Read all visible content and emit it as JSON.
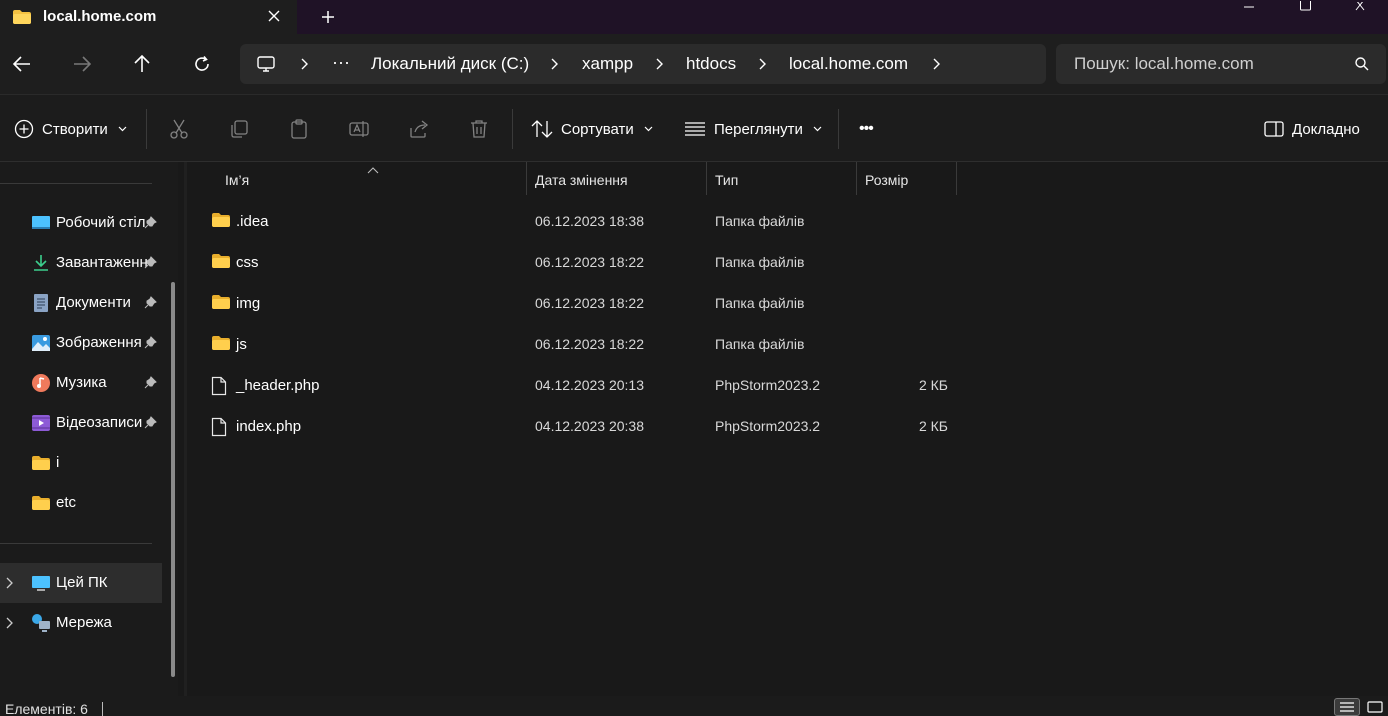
{
  "window": {
    "tab_title": "local.home.com",
    "colors": {
      "titlebar": "#1f1226",
      "folder": "#f5c242",
      "accent": "#4cc2ff"
    }
  },
  "nav": {
    "back_icon": "arrow-left-icon",
    "forward_icon": "arrow-right-icon",
    "up_icon": "arrow-up-icon",
    "refresh_icon": "refresh-icon"
  },
  "address": {
    "overflow": "···",
    "crumbs": [
      "Локальний диск (C:)",
      "xampp",
      "htdocs",
      "local.home.com"
    ]
  },
  "search": {
    "placeholder": "Пошук: local.home.com"
  },
  "toolbar": {
    "new_label": "Створити",
    "sort_label": "Сортувати",
    "view_label": "Переглянути",
    "more_label": "•••",
    "details_label": "Докладно"
  },
  "sidebar": {
    "quick": [
      {
        "label": "Робочий стіл",
        "icon": "desktop-icon",
        "pinned": true
      },
      {
        "label": "Завантаження",
        "icon": "download-icon",
        "pinned": true
      },
      {
        "label": "Документи",
        "icon": "document-icon",
        "pinned": true
      },
      {
        "label": "Зображення",
        "icon": "pictures-icon",
        "pinned": true
      },
      {
        "label": "Музика",
        "icon": "music-icon",
        "pinned": true
      },
      {
        "label": "Відеозаписи",
        "icon": "video-icon",
        "pinned": true
      },
      {
        "label": "i",
        "icon": "folder-icon",
        "pinned": false
      },
      {
        "label": "etc",
        "icon": "folder-icon",
        "pinned": false
      }
    ],
    "this_pc": "Цей ПК",
    "network": "Мережа"
  },
  "columns": {
    "name": "Ім’я",
    "date": "Дата змінення",
    "type": "Тип",
    "size": "Розмір"
  },
  "files": [
    {
      "name": ".idea",
      "date": "06.12.2023 18:38",
      "type": "Папка файлів",
      "size": "",
      "kind": "folder"
    },
    {
      "name": "css",
      "date": "06.12.2023 18:22",
      "type": "Папка файлів",
      "size": "",
      "kind": "folder"
    },
    {
      "name": "img",
      "date": "06.12.2023 18:22",
      "type": "Папка файлів",
      "size": "",
      "kind": "folder"
    },
    {
      "name": "js",
      "date": "06.12.2023 18:22",
      "type": "Папка файлів",
      "size": "",
      "kind": "folder"
    },
    {
      "name": "_header.php",
      "date": "04.12.2023 20:13",
      "type": "PhpStorm2023.2",
      "size": "2 КБ",
      "kind": "file"
    },
    {
      "name": "index.php",
      "date": "04.12.2023 20:38",
      "type": "PhpStorm2023.2",
      "size": "2 КБ",
      "kind": "file"
    }
  ],
  "status": {
    "count": "Елементів: 6"
  }
}
